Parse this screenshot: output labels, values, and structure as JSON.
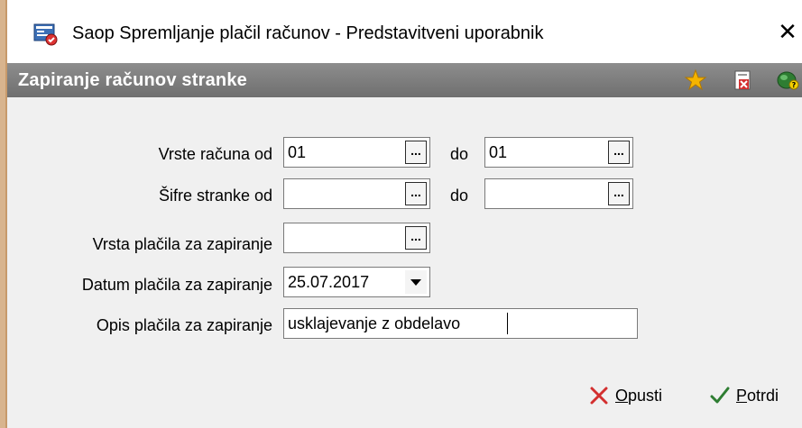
{
  "window": {
    "title": "Saop Spremljanje plačil računov - Predstavitveni uporabnik",
    "close_glyph": "✕"
  },
  "header": {
    "title": "Zapiranje računov stranke",
    "icons": [
      "star-icon",
      "document-delete-icon",
      "help-icon"
    ]
  },
  "form": {
    "vrste_racuna": {
      "label": "Vrste računa od",
      "from_value": "01",
      "to_label": "do",
      "to_value": "01"
    },
    "sifre_stranke": {
      "label": "Šifre stranke od",
      "from_value": "",
      "to_label": "do",
      "to_value": ""
    },
    "vrsta_placila": {
      "label": "Vrsta plačila za zapiranje",
      "value": ""
    },
    "datum_placila": {
      "label": "Datum plačila za zapiranje",
      "value": "25.07.2017"
    },
    "opis_placila": {
      "label": "Opis plačila za zapiranje",
      "value": "usklajevanje z obdelavo"
    },
    "browse_glyph": "..."
  },
  "footer": {
    "cancel": {
      "mnemonic": "O",
      "rest": "pusti"
    },
    "confirm": {
      "mnemonic": "P",
      "rest": "otrdi"
    }
  },
  "colors": {
    "header_bg": "#7a7a7a",
    "content_bg": "#f0f0f0",
    "cancel_icon": "#d32f2f",
    "confirm_icon": "#2e7d32",
    "star": "#f5b400"
  }
}
